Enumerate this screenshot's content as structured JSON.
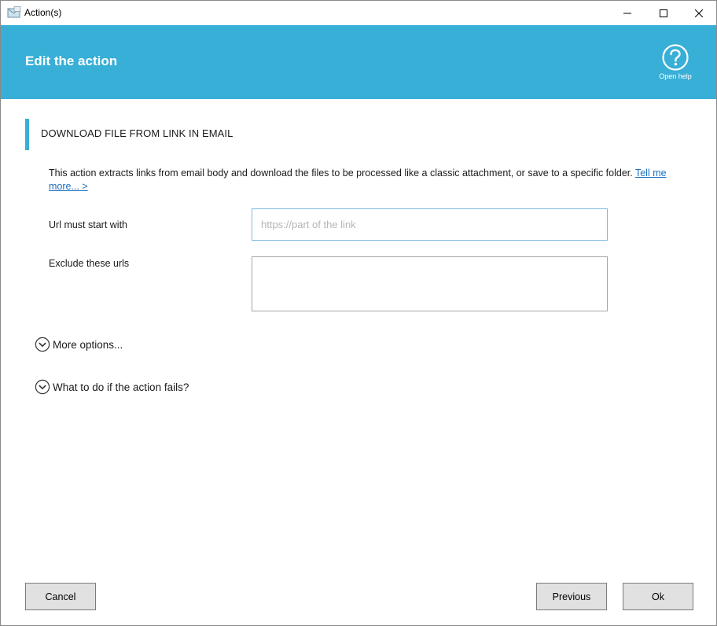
{
  "window": {
    "title": "Action(s)",
    "icon": "envelope-app-icon",
    "controls": {
      "minimize": "minimize-icon",
      "maximize": "maximize-icon",
      "close": "close-icon"
    }
  },
  "header": {
    "title": "Edit the action",
    "help_label": "Open help",
    "help_icon": "question-circle-icon",
    "background_color": "#38afd6"
  },
  "section": {
    "title": "DOWNLOAD FILE FROM LINK IN EMAIL",
    "accent_color": "#38afd6"
  },
  "description": {
    "text": "This action extracts links from email body and download the files to be processed like a classic attachment, or save to a specific folder. ",
    "link_text": "Tell me more... >"
  },
  "form": {
    "url_label": "Url must start with",
    "url_placeholder": "https://part of the link",
    "url_value": "",
    "exclude_label": "Exclude these urls",
    "exclude_value": ""
  },
  "expanders": {
    "more_options": "More options...",
    "on_fail": "What to do if the action fails?",
    "icon": "chevron-down-circle-icon"
  },
  "buttons": {
    "cancel": "Cancel",
    "previous": "Previous",
    "ok": "Ok"
  }
}
